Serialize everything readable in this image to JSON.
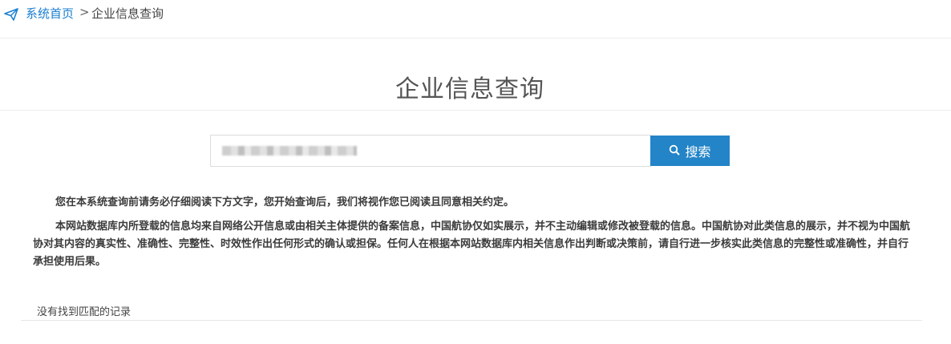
{
  "breadcrumb": {
    "icon": "paper-plane-icon",
    "home": "系统首页",
    "separator": ">",
    "current": "企业信息查询"
  },
  "page": {
    "title": "企业信息查询"
  },
  "search": {
    "value": "",
    "placeholder": "",
    "button_label": "搜索",
    "button_icon": "search-icon",
    "button_color": "#2384c8"
  },
  "notice": {
    "paragraph1": "您在本系统查询前请务必仔细阅读下方文字，您开始查询后，我们将视作您已阅读且同意相关约定。",
    "paragraph2": "本网站数据库内所登载的信息均来自网络公开信息或由相关主体提供的备案信息，中国航协仅如实展示，并不主动编辑或修改被登载的信息。中国航协对此类信息的展示，并不视为中国航协对其内容的真实性、准确性、完整性、时效性作出任何形式的确认或担保。任何人在根据本网站数据库内相关信息作出判断或决策前，请自行进一步核实此类信息的完整性或准确性，并自行承担使用后果。"
  },
  "result": {
    "empty_message": "没有找到匹配的记录"
  }
}
